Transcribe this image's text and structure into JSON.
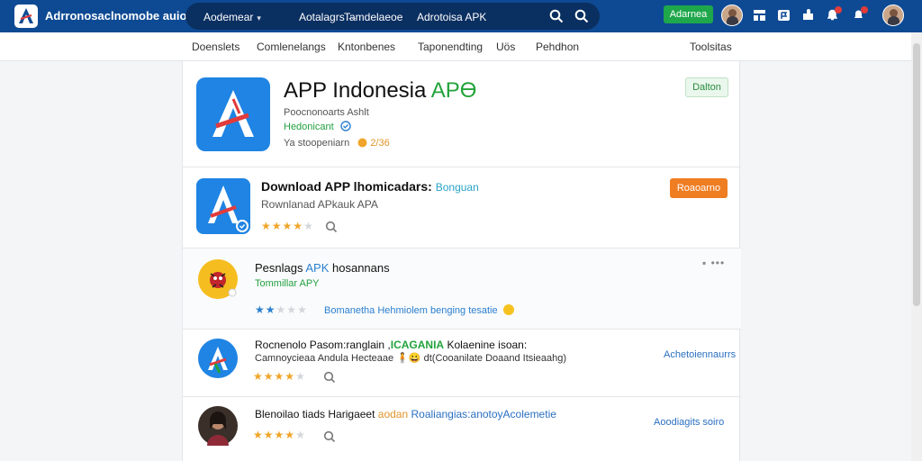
{
  "topbar": {
    "brand": "Adrronosaclnomobe auiod",
    "nav": [
      {
        "label": "Aodemear",
        "caret": "▾"
      },
      {
        "label": "Aotalagrs",
        "caret": "⋯"
      },
      {
        "label": "Tamdelaeoe"
      },
      {
        "label": "Adrotoisa APK"
      }
    ],
    "action_button": "Adarnea",
    "colors": {
      "bar": "#0e4a93",
      "pill": "#0a2f61",
      "green": "#1fa74b"
    }
  },
  "subnav": [
    "Doenslets",
    "Comlenelangs",
    "Kntonbenes",
    "Taponendting",
    "Uös",
    "Pehdhon",
    "Toolsitas"
  ],
  "header": {
    "title_prefix": "APP Indonesia ",
    "title_suffix": "APϴ",
    "meta_line": "Poocnonoarts Ashlt",
    "category": "Hedonicant",
    "stats_label": "Ya stoopeniarn",
    "stats_value": "2/36",
    "follow_button": "Dalton"
  },
  "featured": {
    "title": "Download APP lhomicadars:",
    "title_tag": "Bonguan",
    "subtitle": "Rownlanad APkauk APA",
    "button": "Roaoarno",
    "rating": 4
  },
  "items": [
    {
      "title_prefix": "Pesnlags ",
      "title_highlight": "APK",
      "title_suffix": " hosannans",
      "subtitle": "Tommillar APY",
      "caption": "Bomanetha Hehmiolem benging tesatie",
      "rating": 2,
      "more": "▪ •••"
    },
    {
      "title_prefix": "Rocnenolo Pasom:ranglain ,",
      "title_highlight": "ICAGANIA",
      "title_suffix": " Kolaenine isoan:",
      "subtitle": "Camnoycieaa Andula Hecteaae  🧍😀  dt(Cooanilate Doaand Itsieaahg)",
      "rating": 4,
      "link": "Achetoiennaurrs"
    },
    {
      "title_prefix": "Blenoilao tiads Harigaeet ",
      "title_highlight": "aodan",
      "title_suffix": " Roaliangias:anotoyAcolemetie",
      "rating": 4,
      "link": "Aoodiagits soiro"
    }
  ]
}
